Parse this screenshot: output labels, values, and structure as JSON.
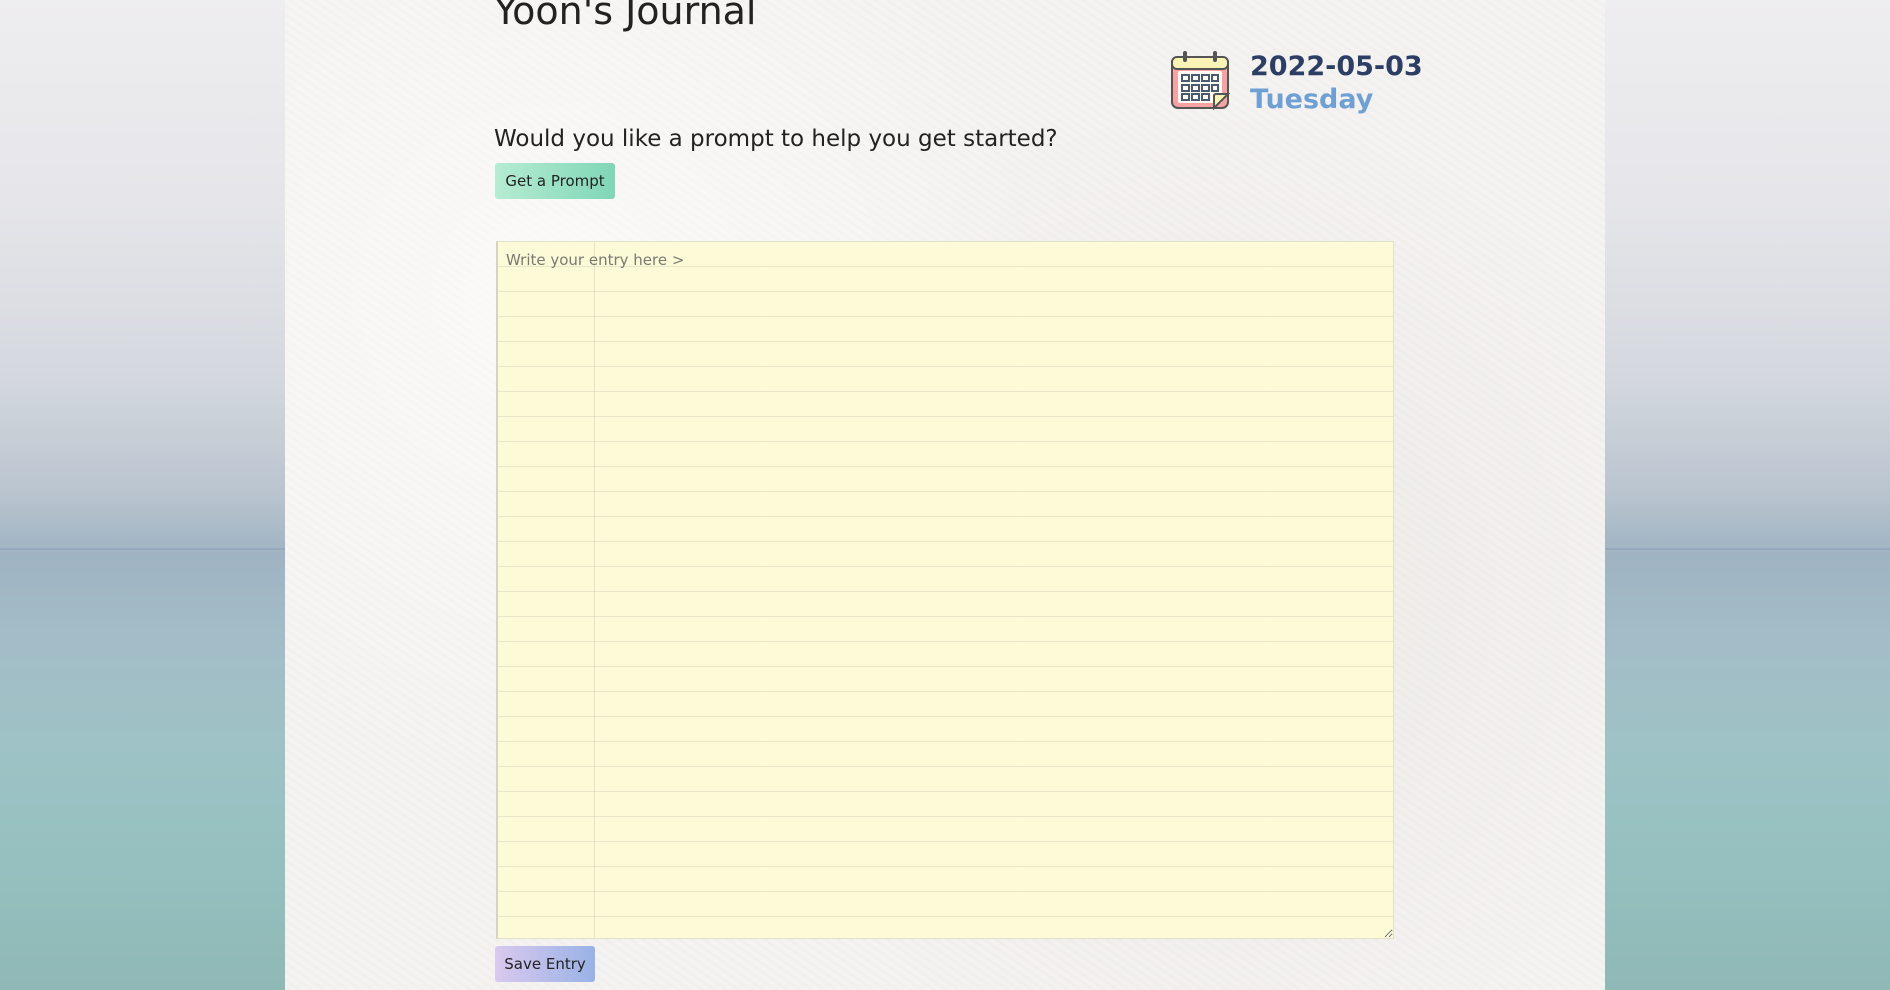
{
  "journal": {
    "title": "Yoon's Journal"
  },
  "date": {
    "date": "2022-05-03",
    "day": "Tuesday",
    "icon": "calendar-icon"
  },
  "prompt": {
    "question": "Would you like a prompt to help you get started?",
    "button_label": "Get a Prompt"
  },
  "entry": {
    "placeholder": "Write your entry here >",
    "value": ""
  },
  "actions": {
    "save_label": "Save Entry"
  },
  "colors": {
    "date_text": "#2c3e63",
    "day_text": "#6fa0d3",
    "prompt_button": "#9fe0c4",
    "save_button": "#b9bfe9",
    "entry_background": "#fcfad7"
  }
}
